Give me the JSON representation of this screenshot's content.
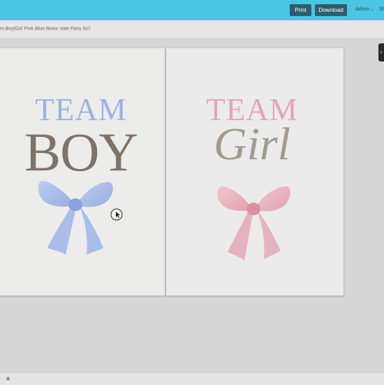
{
  "toolbar": {
    "print_label": "Print",
    "download_label": "Download",
    "admin_label": "Admin",
    "share_label": "Sl"
  },
  "document": {
    "title": "m Boy|Girl Pink Blue Bows Vote Fans 5x7"
  },
  "pages": {
    "boy": {
      "team": "TEAM",
      "word": "BOY"
    },
    "girl": {
      "team": "TEAM",
      "word": "Girl"
    }
  },
  "bottombar": {
    "add_label": "+"
  },
  "colors": {
    "accent": "#49c6e2",
    "button": "#2e5d6f",
    "blue_text": "#9fb2dc",
    "pink_text": "#dea8b5",
    "taupe_text": "#7d7368"
  },
  "icons": [
    "chevron-down-icon",
    "chevron-right-icon",
    "cursor-icon",
    "blue-bow-icon",
    "pink-bow-icon",
    "plus-icon"
  ]
}
